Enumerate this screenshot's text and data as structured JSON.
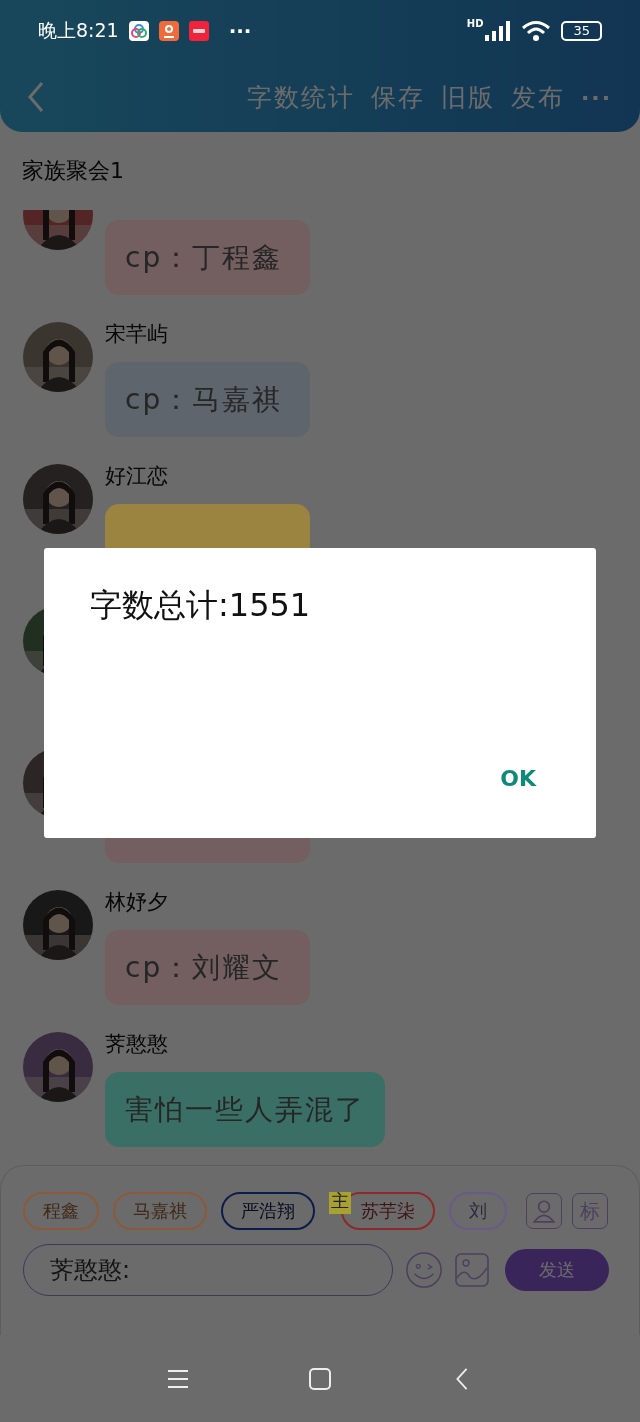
{
  "status_bar": {
    "time": "晚上8:21",
    "more": "···",
    "network": "HD",
    "battery": "35"
  },
  "header": {
    "actions": [
      "字数统计",
      "保存",
      "旧版",
      "发布"
    ],
    "more": "···"
  },
  "chat": {
    "title": "家族聚会1",
    "messages": [
      {
        "avatar": {
          "kind": "picture"
        },
        "text": "cp：丁程鑫",
        "color": "#735f5f"
      },
      {
        "avatar": {
          "kind": "picture"
        },
        "name": "宋芊屿",
        "text": "cp：马嘉祺",
        "color": "#5f656d"
      },
      {
        "avatar": {
          "kind": "picture"
        },
        "name": "好江恋",
        "color": "#9a8440"
      },
      {
        "avatar": {
          "kind": "picture"
        }
      },
      {
        "avatar": {
          "kind": "picture"
        },
        "color": "#735f5f"
      },
      {
        "avatar": {
          "kind": "picture"
        },
        "name": "林妤夕",
        "text": "cp：刘耀文",
        "color": "#735f5f"
      },
      {
        "avatar": {
          "kind": "picture"
        },
        "name": "荠憨憨",
        "text": "害怕一些人弄混了",
        "color": "#3a6f66"
      }
    ]
  },
  "composer": {
    "chips": [
      {
        "label": "程鑫",
        "color": "#8c5a38"
      },
      {
        "label": "马嘉祺",
        "color": "#8c5a38"
      },
      {
        "label": "严浩翔",
        "color": "#0d1d4a"
      },
      {
        "label": "苏芋柒",
        "color": "#8c2a2a",
        "badge": "主"
      },
      {
        "label": "刘",
        "color": "#6a5a8a"
      }
    ],
    "tag_button": "标",
    "input": {
      "value": "荠憨憨:"
    },
    "send": "发送"
  },
  "dialog": {
    "message": "字数总计:1551",
    "ok": "OK"
  }
}
